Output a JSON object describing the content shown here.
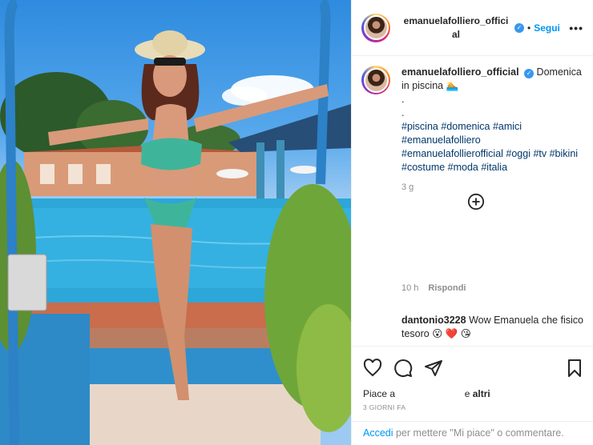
{
  "post": {
    "username": "emanuelafolliero_official",
    "header_username_line1": "emanuelafolliero_offici",
    "header_username_line2": "al",
    "separator": "•",
    "follow_label": "Segui",
    "more_label": "•••",
    "caption": {
      "username": "emanuelafolliero_official",
      "first_line": "Domenica in piscina 🏊",
      "dots": [
        ".",
        "."
      ],
      "hashtags": "#piscina #domenica #amici #emanuelafolliero #emanuelafollierofficial #oggi #tv #bikini #costume #moda #italia",
      "time": "3 g"
    },
    "reply_row": {
      "time": "10 h",
      "reply_label": "Rispondi"
    },
    "comment": {
      "username": "dantonio3228",
      "text": "Wow Emanuela che fisico tesoro 😮 ❤️ 😘"
    },
    "likes": {
      "prefix": "Piace a",
      "suffix": "e",
      "others": "altri"
    },
    "date": "3 GIORNI FA",
    "footer": {
      "login_label": "Accedi",
      "rest": "per mettere \"Mi piace\" o commentare."
    },
    "icons": {
      "like": "heart-icon",
      "comment": "comment-icon",
      "share": "send-icon",
      "save": "bookmark-icon",
      "add": "plus-circle-icon",
      "verified": "verified-badge-icon"
    },
    "colors": {
      "accent": "#0095f6",
      "verified": "#3897f0",
      "hashtag": "#00376b",
      "muted": "#8e8e8e"
    }
  }
}
